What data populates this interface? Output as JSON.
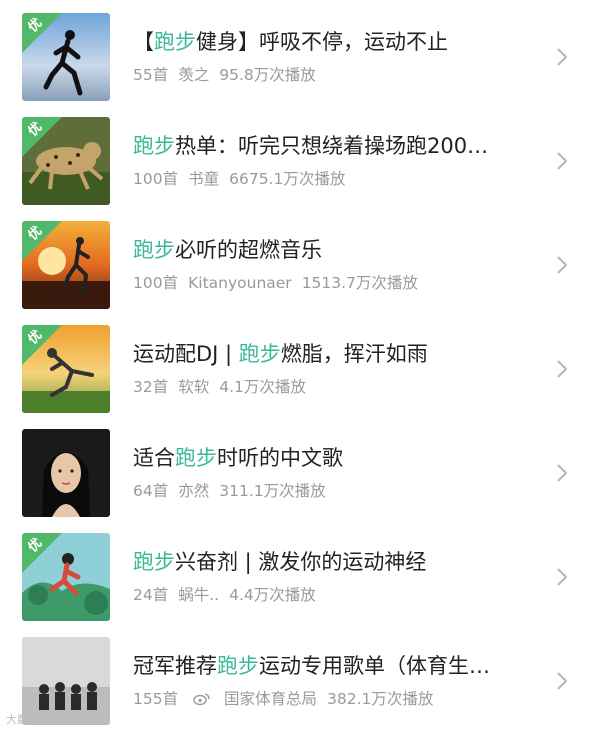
{
  "colors": {
    "accent": "#3bb89a",
    "title": "#222222",
    "meta": "#9a9a9a",
    "badge": "#52b96b"
  },
  "playlists": [
    {
      "pre": "【",
      "hl": "跑步",
      "post": "健身】呼吸不停，运动不止",
      "count": "55首",
      "author": "羡之",
      "plays": "95.8万次播放",
      "badge": "优",
      "cover_icon": "runner-silhouette"
    },
    {
      "pre": "",
      "hl": "跑步",
      "post": "热单：听完只想绕着操场跑200…",
      "count": "100首",
      "author": "书童",
      "plays": "6675.1万次播放",
      "badge": "优",
      "cover_icon": "cheetah"
    },
    {
      "pre": "",
      "hl": "跑步",
      "post": "必听的超燃音乐",
      "count": "100首",
      "author": "Kitanyounaer",
      "plays": "1513.7万次播放",
      "badge": "优",
      "cover_icon": "sunset-runner"
    },
    {
      "pre": "运动配DJ | ",
      "hl": "跑步",
      "post": "燃脂，挥汗如雨",
      "count": "32首",
      "author": "软软",
      "plays": "4.1万次播放",
      "badge": "优",
      "cover_icon": "sprinter"
    },
    {
      "pre": "适合",
      "hl": "跑步",
      "post": "时听的中文歌",
      "count": "64首",
      "author": "亦然",
      "plays": "311.1万次播放",
      "badge": "",
      "cover_icon": "portrait"
    },
    {
      "pre": "",
      "hl": "跑步",
      "post": "兴奋剂 | 激发你的运动神经",
      "count": "24首",
      "author": "蜗牛..",
      "plays": "4.4万次播放",
      "badge": "优",
      "cover_icon": "cartoon-runner"
    },
    {
      "pre": "冠军推荐",
      "hl": "跑步",
      "post": "运动专用歌单（体育生…",
      "count": "155首",
      "author": "国家体育总局",
      "plays": "382.1万次播放",
      "badge": "",
      "cover_icon": "group-photo",
      "author_icon": "weibo-icon"
    }
  ],
  "watermark": "大数跑步"
}
